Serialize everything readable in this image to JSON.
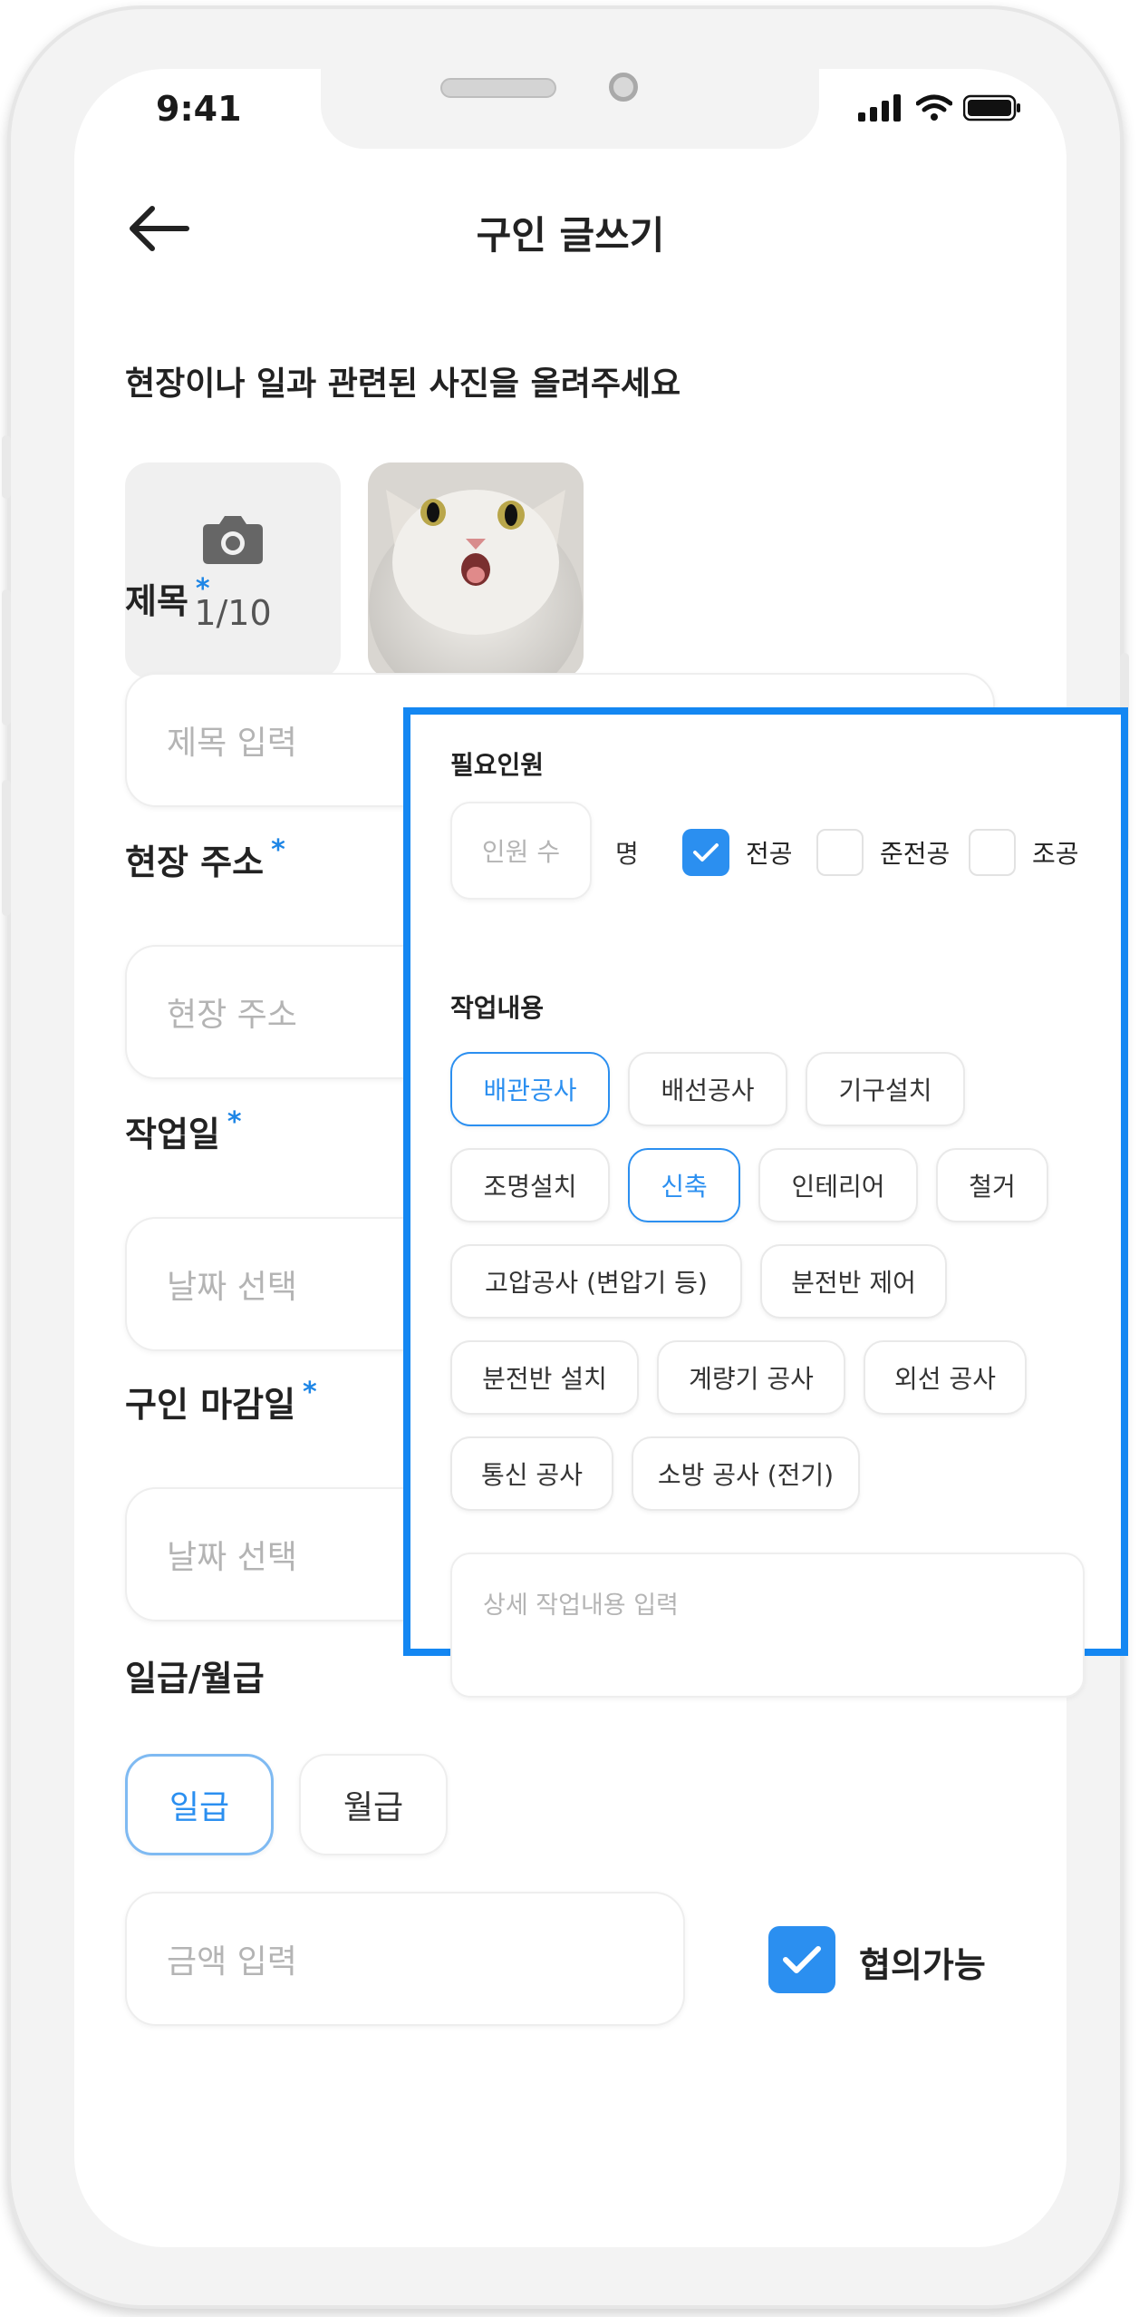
{
  "status_bar": {
    "time": "9:41"
  },
  "header": {
    "title": "구인 글쓰기"
  },
  "photos": {
    "prompt": "현장이나 일과 관련된 사진을 올려주세요",
    "count": "1/10"
  },
  "title_field": {
    "label": "제목",
    "required": "*",
    "placeholder": "제목 입력"
  },
  "address_field": {
    "label": "현장 주소",
    "required": "*",
    "placeholder": "현장 주소"
  },
  "workdate_field": {
    "label": "작업일",
    "required": "*",
    "placeholder": "날짜 선택"
  },
  "deadline_field": {
    "label": "구인 마감일",
    "required": "*",
    "placeholder": "날짜 선택"
  },
  "pay": {
    "label": "일급/월급",
    "options": [
      "일급",
      "월급"
    ],
    "selected": "일급",
    "amount_placeholder": "금액 입력",
    "negotiable_label": "협의가능",
    "negotiable_checked": true
  },
  "popup": {
    "personnel": {
      "label": "필요인원",
      "count_placeholder": "인원 수",
      "unit": "명",
      "grades": [
        {
          "label": "전공",
          "checked": true
        },
        {
          "label": "준전공",
          "checked": false
        },
        {
          "label": "조공",
          "checked": false
        }
      ]
    },
    "work": {
      "label": "작업내용",
      "chips": [
        {
          "label": "배관공사",
          "active": true
        },
        {
          "label": "배선공사",
          "active": false
        },
        {
          "label": "기구설치",
          "active": false
        },
        {
          "label": "조명설치",
          "active": false
        },
        {
          "label": "신축",
          "active": true
        },
        {
          "label": "인테리어",
          "active": false
        },
        {
          "label": "철거",
          "active": false
        },
        {
          "label": "고압공사 (변압기 등)",
          "active": false
        },
        {
          "label": "분전반 제어",
          "active": false
        },
        {
          "label": "분전반 설치",
          "active": false
        },
        {
          "label": "계량기 공사",
          "active": false
        },
        {
          "label": "외선 공사",
          "active": false
        },
        {
          "label": "통신 공사",
          "active": false
        },
        {
          "label": "소방 공사 (전기)",
          "active": false
        }
      ],
      "detail_placeholder": "상세 작업내용 입력"
    }
  },
  "colors": {
    "accent": "#2b8ff0",
    "highlight_border": "#1487f2"
  },
  "icons": [
    "back-arrow-icon",
    "camera-icon",
    "calendar-icon",
    "check-icon",
    "signal-icon",
    "wifi-icon",
    "battery-icon"
  ]
}
